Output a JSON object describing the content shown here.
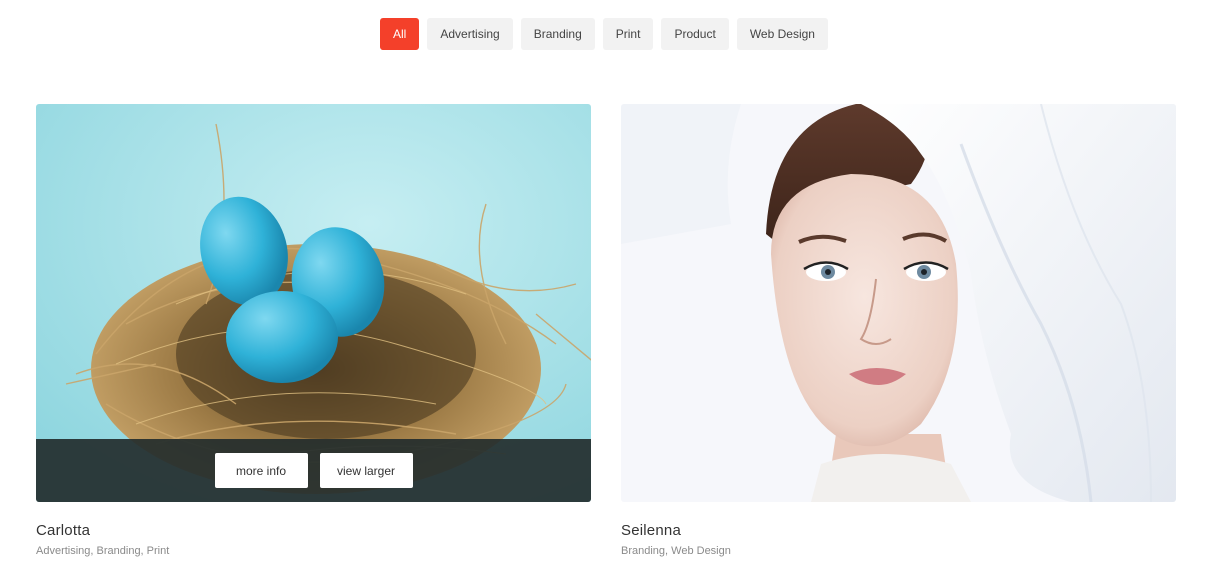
{
  "filters": [
    {
      "label": "All",
      "active": true
    },
    {
      "label": "Advertising",
      "active": false
    },
    {
      "label": "Branding",
      "active": false
    },
    {
      "label": "Print",
      "active": false
    },
    {
      "label": "Product",
      "active": false
    },
    {
      "label": "Web Design",
      "active": false
    }
  ],
  "portfolio": [
    {
      "title": "Carlotta",
      "tags": "Advertising, Branding, Print",
      "image_subject": "blue eggs in a bird nest",
      "overlay": {
        "more_info_label": "more info",
        "view_larger_label": "view larger"
      }
    },
    {
      "title": "Seilenna",
      "tags": "Branding, Web Design",
      "image_subject": "woman portrait with white veil"
    }
  ],
  "colors": {
    "accent": "#f4402a",
    "filter_bg": "#f2f2f2",
    "overlay_bg": "#232d2d",
    "tag_text": "#8a8a8a"
  }
}
